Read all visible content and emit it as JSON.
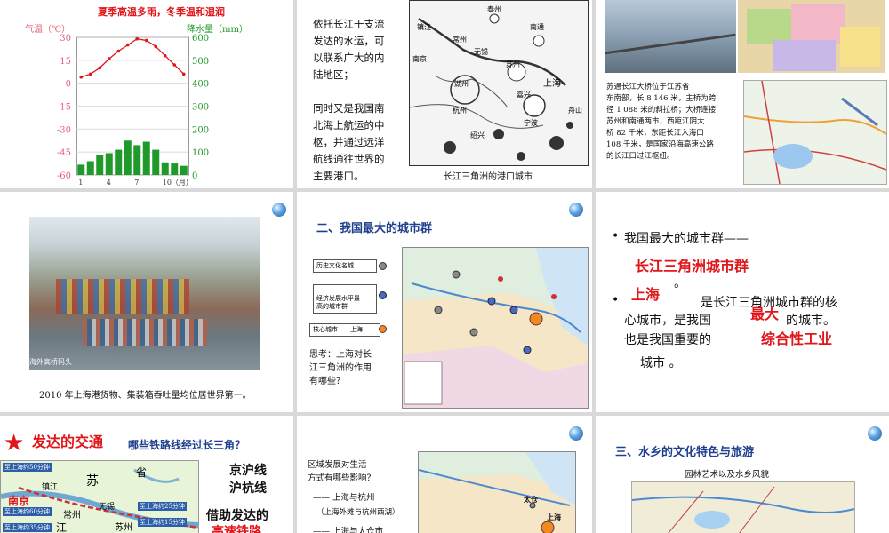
{
  "s1": {
    "title": "夏季高温多雨，冬季温和湿润",
    "left_axis_label": "气温（℃）",
    "right_axis_label": "降水量（mm）",
    "left_ticks": [
      "30",
      "15",
      "0",
      "-15",
      "-30",
      "-45",
      "-60"
    ],
    "right_ticks": [
      "600",
      "500",
      "400",
      "300",
      "200",
      "100",
      "0"
    ],
    "x_ticks": [
      "1",
      "4",
      "7",
      "10（月）"
    ]
  },
  "chart_data": {
    "type": "line",
    "x": [
      1,
      2,
      3,
      4,
      5,
      6,
      7,
      8,
      9,
      10,
      11,
      12
    ],
    "series": [
      {
        "values": [
          4,
          6,
          10,
          16,
          21,
          25,
          29,
          28,
          24,
          18,
          12,
          6
        ]
      },
      {
        "values": [
          45,
          60,
          85,
          95,
          110,
          150,
          130,
          145,
          110,
          55,
          50,
          40
        ]
      }
    ],
    "ylim_left": [
      -60,
      30
    ],
    "ylim_right": [
      0,
      600
    ]
  },
  "s2": {
    "body": "依托长江干支流\n发达的水运，可\n以联系广大的内\n陆地区；\n\n同时又是我国南\n北海上航运的中\n枢，并通过远洋\n航线通往世界的\n主要港口。",
    "caption": "长江三角洲的港口城市",
    "map_labels": [
      "泰州",
      "镇江",
      "南通",
      "常州",
      "南京",
      "无锡",
      "苏州",
      "上海",
      "湖州",
      "嘉兴",
      "杭州",
      "宁波",
      "绍兴",
      "舟山"
    ]
  },
  "s3": {
    "body": "苏通长江大桥位于江苏省\n东南部，长 8 146 米，主桥为跨\n径 1 088 米的斜拉桥；大桥连接\n苏州和南通两市，西距江阴大\n桥 82 千米，东距长江入海口\n108 千米，是国家沿海高速公路\n的长江口过江枢纽。"
  },
  "s4": {
    "photo_label": "海外高桥码头",
    "caption": "2010 年上海港货物、集装箱吞吐量均位居世界第一。"
  },
  "s5": {
    "title": "二、我国最大的城市群",
    "legend": [
      "历史文化名城",
      "经济发展水平最\n高的城市群",
      "核心城市——上海"
    ],
    "question": "思考：上海对长\n江三角洲的作用\n有哪些？"
  },
  "s6": {
    "line1": "我国最大的城市群——",
    "answer1": "长江三角洲城市群",
    "period": "。",
    "answer2": "上海",
    "line2": "是长江三角洲城市群的核",
    "line3": "心城市，是我国",
    "answer3": "最大",
    "line4": "的城市。",
    "line5": "也是我国重要的",
    "answer4": "综合性工业",
    "line6": "城市 。"
  },
  "s7": {
    "title": "发达的交通",
    "question": "哪些铁路线经过长三角？",
    "answer": "京沪线\n沪杭线",
    "body": "借助发达的",
    "red": "高速铁路",
    "map_labels": [
      "至上海约50分钟",
      "南京",
      "镇江",
      "苏",
      "省",
      "至上海约60分钟",
      "常州",
      "无锡",
      "至上海约25分钟",
      "至上海约35分钟",
      "江",
      "苏州",
      "至上海约15分钟"
    ]
  },
  "s8": {
    "body": "区域发展对生活\n方式有哪些影响？",
    "items": [
      "—— 上海与杭州",
      "（上海外滩与杭州西湖）",
      "—— 上海与太仓市"
    ],
    "map_labels": [
      "太仓",
      "上海"
    ]
  },
  "s9": {
    "title": "三、水乡的文化特色与旅游",
    "caption": "园林艺术以及水乡风貌"
  },
  "colors": {
    "red": "#e0161b",
    "blue": "#1f3f8f",
    "green": "#1f9a2a",
    "pink": "#e0607a"
  }
}
